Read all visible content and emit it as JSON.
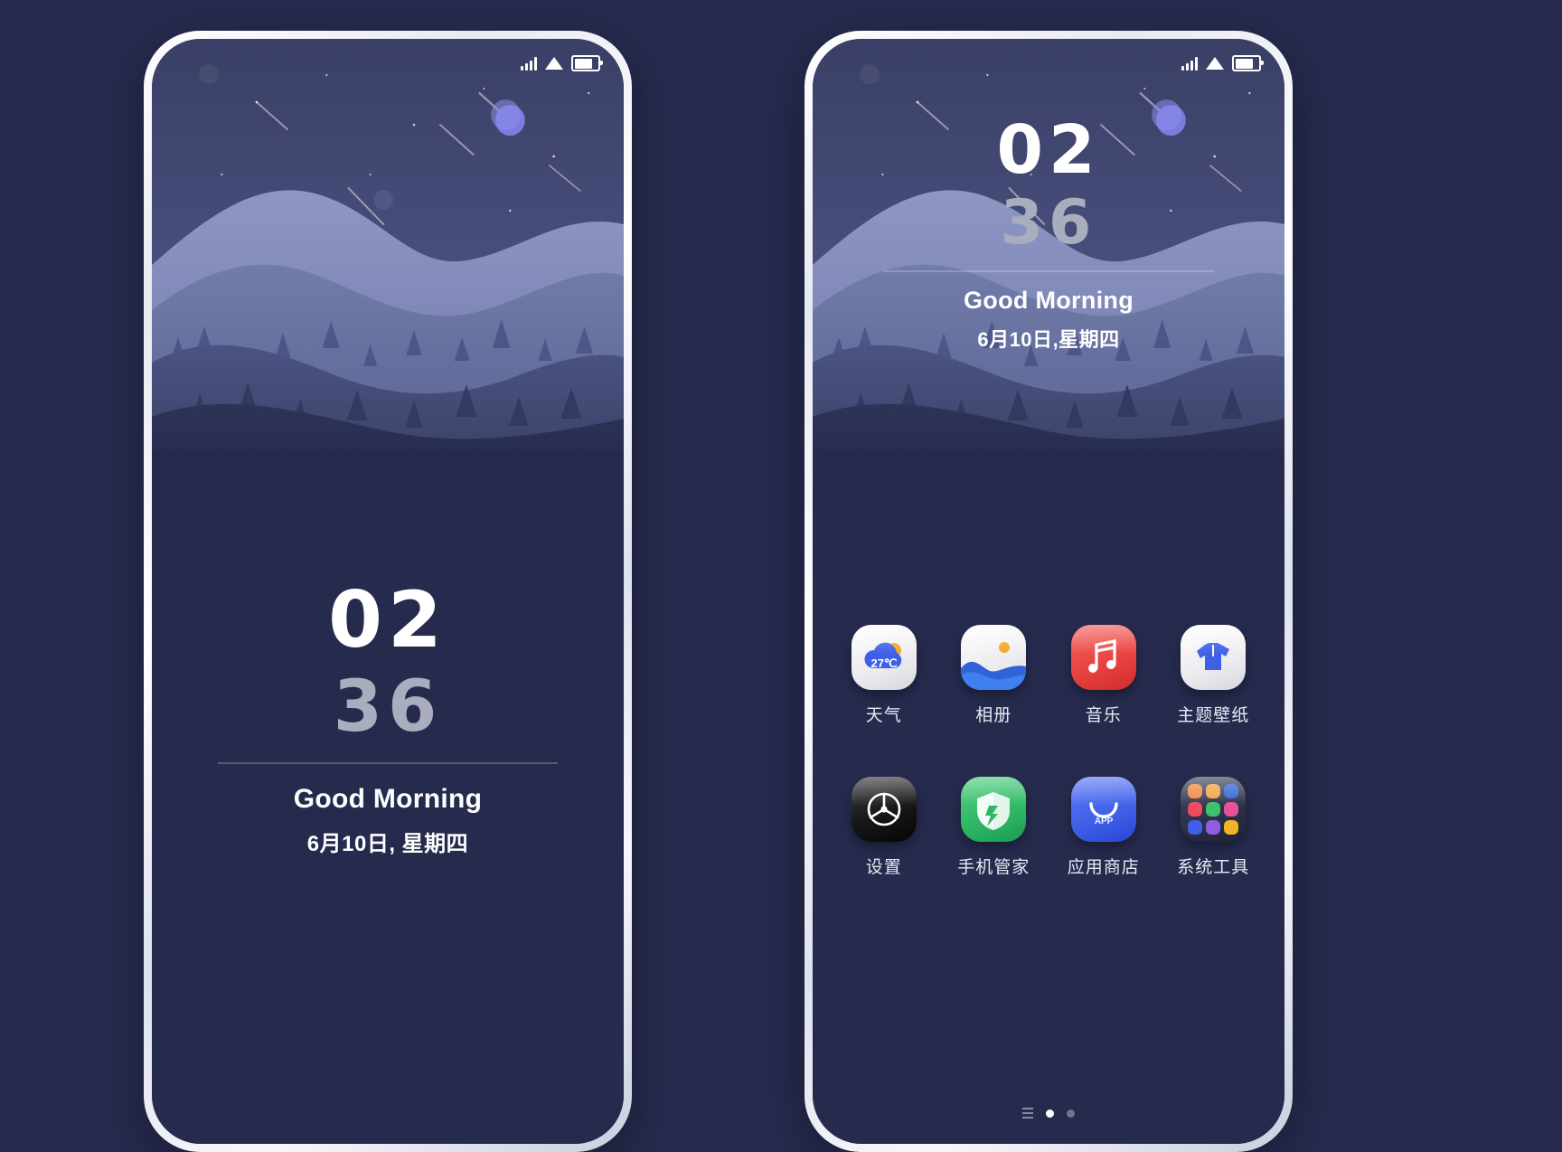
{
  "page": {
    "background_color": "#262b4e",
    "title": "MIUI Theme Preview - Lock Screen and Home Screen"
  },
  "status_bar": {
    "signal_icon": "signal-bars-icon",
    "wifi_icon": "wifi-icon",
    "battery_icon": "battery-icon"
  },
  "lock_screen": {
    "hours": "02",
    "minutes": "36",
    "greeting": "Good Morning",
    "date": "6月10日, 星期四"
  },
  "home_screen": {
    "hours": "02",
    "minutes": "36",
    "greeting": "Good Morning",
    "date": "6月10日,星期四",
    "apps": [
      {
        "label": "天气",
        "icon": "weather-icon",
        "style": "white",
        "badge": "27℃"
      },
      {
        "label": "相册",
        "icon": "gallery-icon",
        "style": "white",
        "badge": ""
      },
      {
        "label": "音乐",
        "icon": "music-icon",
        "style": "red",
        "badge": ""
      },
      {
        "label": "主题壁纸",
        "icon": "themes-icon",
        "style": "white",
        "badge": ""
      },
      {
        "label": "设置",
        "icon": "settings-icon",
        "style": "black",
        "badge": ""
      },
      {
        "label": "手机管家",
        "icon": "phone-manager-icon",
        "style": "green",
        "badge": ""
      },
      {
        "label": "应用商店",
        "icon": "app-store-icon",
        "style": "blue",
        "badge": "APP"
      },
      {
        "label": "系统工具",
        "icon": "system-tools-folder-icon",
        "style": "folder",
        "badge": ""
      }
    ],
    "page_indicator": {
      "total": 2,
      "current": 1
    }
  },
  "colors": {
    "accent_blue": "#3f5fe8",
    "accent_red": "#e8413f",
    "accent_green": "#2fb765",
    "text_primary": "#ffffff",
    "text_secondary": "#a9adbe"
  }
}
